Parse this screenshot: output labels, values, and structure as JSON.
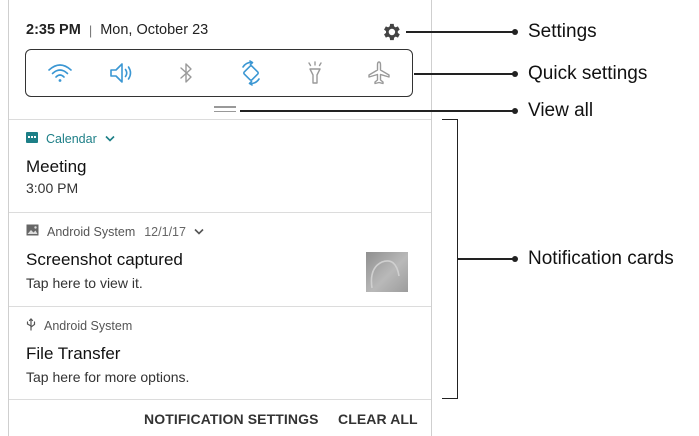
{
  "status_bar": {
    "time": "2:35 PM",
    "separator": "|",
    "date": "Mon, October 23"
  },
  "quick_settings": {
    "icons": [
      "wifi-icon",
      "sound-icon",
      "bluetooth-icon",
      "auto-rotate-icon",
      "flashlight-icon",
      "airplane-icon"
    ],
    "active_color": "#3b97d3",
    "inactive_color": "#9a9a9a"
  },
  "notifications": [
    {
      "app": "Calendar",
      "title": "Meeting",
      "text": "3:00 PM",
      "app_icon": "calendar-icon",
      "app_color": "#1d7f87"
    },
    {
      "app": "Android System",
      "timestamp": "12/1/17",
      "title": "Screenshot captured",
      "text": "Tap here to view it.",
      "app_icon": "image-icon"
    },
    {
      "app": "Android System",
      "title": "File Transfer",
      "text": "Tap here for more options.",
      "app_icon": "usb-icon"
    }
  ],
  "footer": {
    "notification_settings": "NOTIFICATION SETTINGS",
    "clear_all": "CLEAR ALL"
  },
  "callouts": {
    "settings": "Settings",
    "quick_settings": "Quick settings",
    "view_all": "View all",
    "notification_cards": "Notification cards"
  }
}
